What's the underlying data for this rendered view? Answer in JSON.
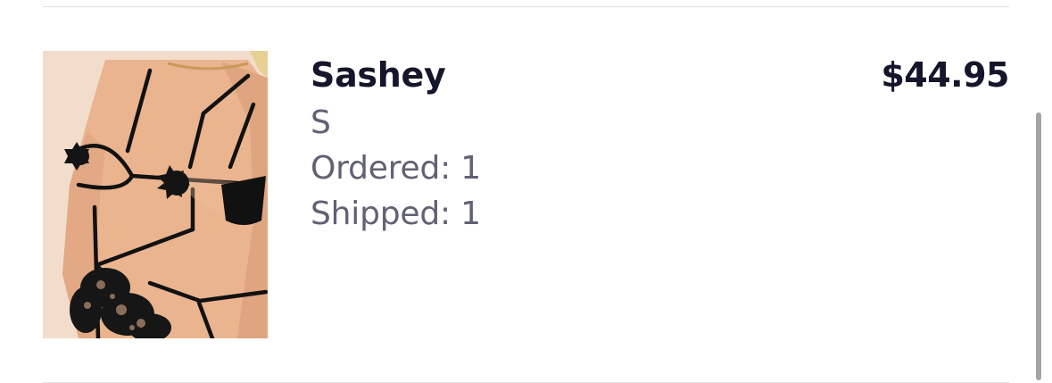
{
  "order_item": {
    "product_name": "Sashey",
    "size": "S",
    "ordered": "Ordered: 1",
    "shipped": "Shipped: 1",
    "price": "$44.95",
    "thumbnail_alt": "Sashey product photo"
  },
  "colors": {
    "title_text": "#15152b",
    "meta_text": "#616174",
    "divider": "#e3e3e6",
    "scrollbar": "#a4a4a4"
  }
}
